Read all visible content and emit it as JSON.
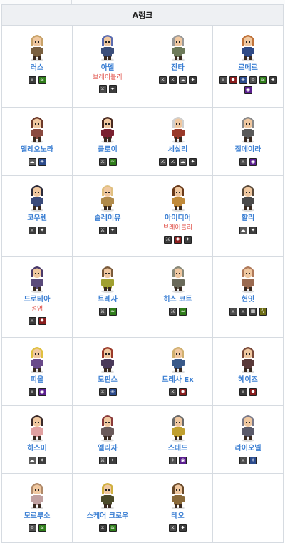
{
  "table": {
    "header": "A랭크"
  },
  "characters": [
    {
      "name": "러스",
      "note": "",
      "hair": "#c8a36a",
      "cloth": "#7a6040",
      "icons": [
        {
          "type": "sword",
          "glyph": "⚔"
        },
        {
          "type": "wind",
          "glyph": "≈"
        }
      ]
    },
    {
      "name": "아델",
      "note": "브레이블리",
      "hair": "#5b6cb0",
      "cloth": "#3b4e7a",
      "icons": [
        {
          "type": "slash",
          "glyph": "⚔"
        },
        {
          "type": "light",
          "glyph": "✦"
        }
      ]
    },
    {
      "name": "잔타",
      "note": "",
      "hair": "#9a9a9a",
      "cloth": "#6d7a5a",
      "icons": [
        {
          "type": "slash",
          "glyph": "⚔"
        },
        {
          "type": "sword",
          "glyph": "⚔"
        },
        {
          "type": "cloud",
          "glyph": "☁"
        },
        {
          "type": "light",
          "glyph": "✦"
        }
      ]
    },
    {
      "name": "르메르",
      "note": "",
      "hair": "#c0733a",
      "cloth": "#2f4a86",
      "icons": [
        {
          "type": "slash",
          "glyph": "⚔"
        },
        {
          "type": "fire",
          "glyph": "✹"
        },
        {
          "type": "ice",
          "glyph": "✳"
        },
        {
          "type": "staff",
          "glyph": "✧"
        },
        {
          "type": "wind",
          "glyph": "≈"
        },
        {
          "type": "light",
          "glyph": "✦"
        },
        {
          "type": "dark",
          "glyph": "◉"
        }
      ]
    },
    {
      "name": "엘레오노라",
      "note": "",
      "hair": "#6e3a2a",
      "cloth": "#8a4a40",
      "icons": [
        {
          "type": "cloud",
          "glyph": "☁"
        },
        {
          "type": "ice",
          "glyph": "✳"
        }
      ]
    },
    {
      "name": "클로이",
      "note": "",
      "hair": "#4a2a20",
      "cloth": "#7a2030",
      "icons": [
        {
          "type": "slash",
          "glyph": "⚔"
        },
        {
          "type": "wind",
          "glyph": "≈"
        }
      ]
    },
    {
      "name": "세실리",
      "note": "",
      "hair": "#d0d0d0",
      "cloth": "#9a3a2a",
      "icons": [
        {
          "type": "slash",
          "glyph": "⚔"
        },
        {
          "type": "sword",
          "glyph": "⚔"
        },
        {
          "type": "cloud",
          "glyph": "☁"
        },
        {
          "type": "light",
          "glyph": "✦"
        }
      ]
    },
    {
      "name": "질메이라",
      "note": "",
      "hair": "#8a8a8a",
      "cloth": "#5a5a5a",
      "icons": [
        {
          "type": "slash",
          "glyph": "⚔"
        },
        {
          "type": "dark",
          "glyph": "◉"
        }
      ]
    },
    {
      "name": "코우렌",
      "note": "",
      "hair": "#2a2a3a",
      "cloth": "#3a4a7a",
      "icons": [
        {
          "type": "sword",
          "glyph": "⚔"
        },
        {
          "type": "light",
          "glyph": "✦"
        }
      ]
    },
    {
      "name": "솔레이유",
      "note": "",
      "hair": "#e0c080",
      "cloth": "#b08a4a",
      "icons": [
        {
          "type": "sword",
          "glyph": "⚔"
        },
        {
          "type": "light",
          "glyph": "✦"
        }
      ]
    },
    {
      "name": "아이디어",
      "note": "브레이블리",
      "hair": "#6a3a1a",
      "cloth": "#c08a3a",
      "icons": [
        {
          "type": "sword",
          "glyph": "⚔"
        },
        {
          "type": "fire",
          "glyph": "✹"
        },
        {
          "type": "light",
          "glyph": "✦"
        }
      ]
    },
    {
      "name": "할리",
      "note": "",
      "hair": "#5a4a3a",
      "cloth": "#4a4a4a",
      "icons": [
        {
          "type": "cloud",
          "glyph": "☁"
        },
        {
          "type": "light",
          "glyph": "✦"
        }
      ]
    },
    {
      "name": "드로테아",
      "note": "성염",
      "hair": "#4a3a6a",
      "cloth": "#5a4a7a",
      "icons": [
        {
          "type": "sword",
          "glyph": "⚔"
        },
        {
          "type": "fire",
          "glyph": "✹"
        }
      ]
    },
    {
      "name": "트레사",
      "note": "",
      "hair": "#7a5a3a",
      "cloth": "#a0a030",
      "icons": [
        {
          "type": "slash",
          "glyph": "⚔"
        },
        {
          "type": "wind",
          "glyph": "≈"
        }
      ]
    },
    {
      "name": "히스 코트",
      "note": "",
      "hair": "#8a8a7a",
      "cloth": "#6a6a5a",
      "icons": [
        {
          "type": "slash",
          "glyph": "⚔"
        },
        {
          "type": "wind",
          "glyph": "≈"
        }
      ]
    },
    {
      "name": "헌잇",
      "note": "",
      "hair": "#b07a5a",
      "cloth": "#9a6a50",
      "icons": [
        {
          "type": "slash",
          "glyph": "⚔"
        },
        {
          "type": "sword",
          "glyph": "⚔"
        },
        {
          "type": "mirror",
          "glyph": "▦"
        },
        {
          "type": "bolt",
          "glyph": "ϟ"
        }
      ]
    },
    {
      "name": "피올",
      "note": "",
      "hair": "#e0c040",
      "cloth": "#6a4a8a",
      "icons": [
        {
          "type": "sword",
          "glyph": "⚔"
        },
        {
          "type": "dark",
          "glyph": "◉"
        }
      ]
    },
    {
      "name": "모핀스",
      "note": "",
      "hair": "#9a3a2a",
      "cloth": "#4a3a5a",
      "icons": [
        {
          "type": "slash",
          "glyph": "⚔"
        },
        {
          "type": "ice",
          "glyph": "✳"
        }
      ]
    },
    {
      "name": "트레사 Ex",
      "note": "",
      "hair": "#d0b070",
      "cloth": "#3a5a8a",
      "icons": [
        {
          "type": "slash",
          "glyph": "⚔"
        },
        {
          "type": "fire",
          "glyph": "✹"
        }
      ]
    },
    {
      "name": "헤이즈",
      "note": "",
      "hair": "#7a4a3a",
      "cloth": "#5a3a3a",
      "icons": [
        {
          "type": "sword",
          "glyph": "⚔"
        },
        {
          "type": "fire",
          "glyph": "✹"
        }
      ]
    },
    {
      "name": "하스미",
      "note": "",
      "hair": "#3a2a2a",
      "cloth": "#e0a0a0",
      "icons": [
        {
          "type": "cloud",
          "glyph": "☁"
        },
        {
          "type": "light",
          "glyph": "✦"
        }
      ]
    },
    {
      "name": "엘리자",
      "note": "",
      "hair": "#8a3a3a",
      "cloth": "#6a5a5a",
      "icons": [
        {
          "type": "slash",
          "glyph": "⚔"
        },
        {
          "type": "light",
          "glyph": "✦"
        }
      ]
    },
    {
      "name": "스테드",
      "note": "",
      "hair": "#6a6a6a",
      "cloth": "#c0a030",
      "icons": [
        {
          "type": "staff",
          "glyph": "✧"
        },
        {
          "type": "dark",
          "glyph": "◉"
        }
      ]
    },
    {
      "name": "라이오넬",
      "note": "",
      "hair": "#7a7a8a",
      "cloth": "#5a5a6a",
      "icons": [
        {
          "type": "slash",
          "glyph": "⚔"
        },
        {
          "type": "ice",
          "glyph": "✳"
        }
      ]
    },
    {
      "name": "모르루소",
      "note": "",
      "hair": "#b08a6a",
      "cloth": "#c0a0a0",
      "icons": [
        {
          "type": "staff",
          "glyph": "✧"
        },
        {
          "type": "wind",
          "glyph": "≈"
        }
      ]
    },
    {
      "name": "스케어 크로우",
      "note": "",
      "hair": "#d0b040",
      "cloth": "#4a4a2a",
      "icons": [
        {
          "type": "sword",
          "glyph": "⚔"
        },
        {
          "type": "wind",
          "glyph": "≈"
        }
      ]
    },
    {
      "name": "테오",
      "note": "",
      "hair": "#6a4a2a",
      "cloth": "#8a6a3a",
      "icons": [
        {
          "type": "slash",
          "glyph": "⚔"
        },
        {
          "type": "light",
          "glyph": "✦"
        }
      ]
    }
  ]
}
